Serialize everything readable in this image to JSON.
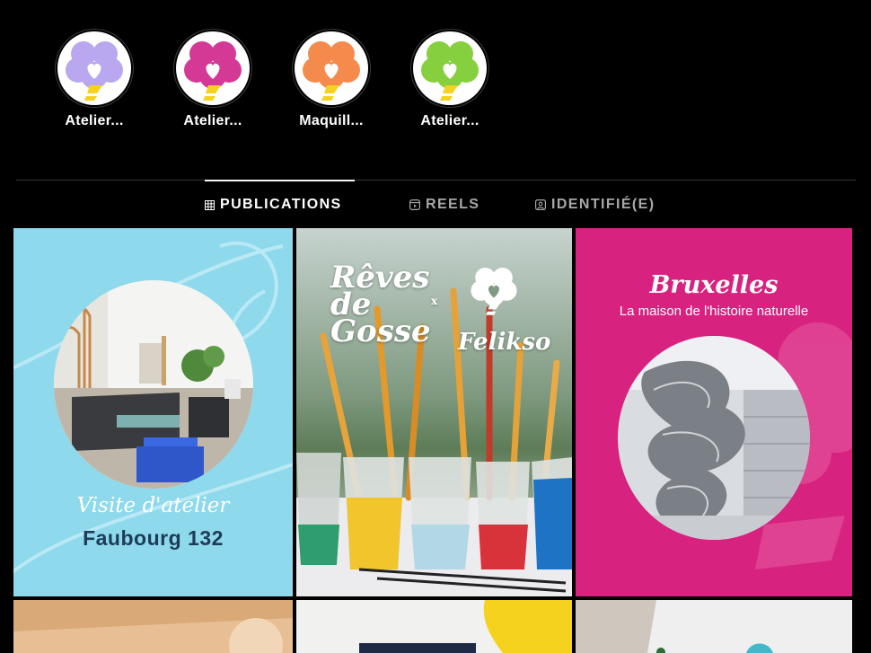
{
  "highlights": [
    {
      "label": "Atelier...",
      "color": "#b9a7ef"
    },
    {
      "label": "Atelier...",
      "color": "#d43a95"
    },
    {
      "label": "Maquill...",
      "color": "#f58a4d"
    },
    {
      "label": "Atelier...",
      "color": "#86cf3f"
    }
  ],
  "tabs": [
    {
      "label": "PUBLICATIONS",
      "icon": "grid-icon",
      "active": true
    },
    {
      "label": "REELS",
      "icon": "reels-icon",
      "active": false
    },
    {
      "label": "IDENTIFIÉ(E)",
      "icon": "tagged-icon",
      "active": false
    }
  ],
  "posts": [
    {
      "title": "Visite d'atelier",
      "subtitle": "Faubourg 132"
    },
    {
      "brand_left": "Rêves de Gosse",
      "connector": "x",
      "brand_right": "Felikso"
    },
    {
      "title": "Bruxelles",
      "subtitle": "La maison de l'histoire naturelle"
    }
  ],
  "colors": {
    "accent_yellow": "#f5d21e",
    "post1_bg": "#8fd9ec",
    "post3_bg": "#d7227f"
  }
}
